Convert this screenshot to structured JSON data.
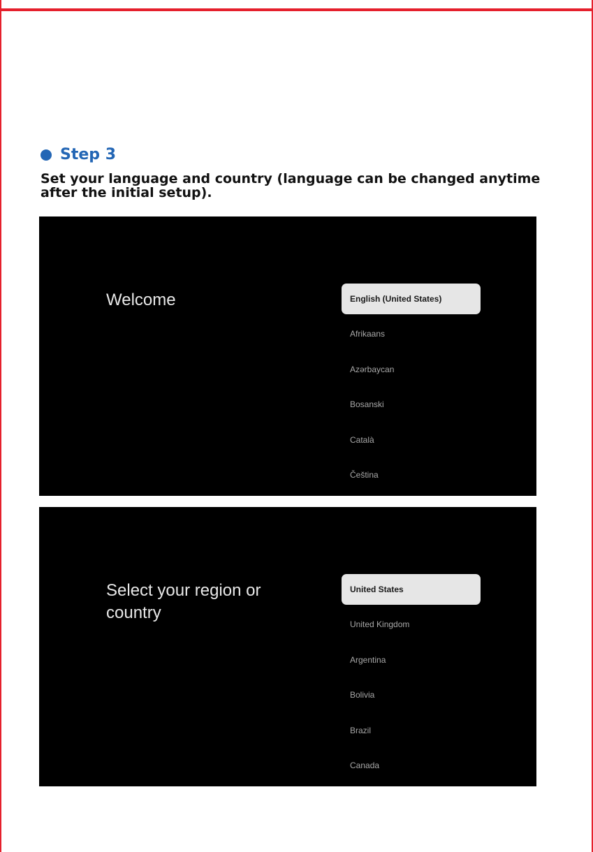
{
  "step": {
    "title": "Step 3",
    "description": "Set your language and country (language can be changed anytime after the initial setup)."
  },
  "screens": [
    {
      "title": "Welcome",
      "options": [
        {
          "label": "English (United States)",
          "selected": true
        },
        {
          "label": "Afrikaans",
          "selected": false
        },
        {
          "label": "Azərbaycan",
          "selected": false
        },
        {
          "label": "Bosanski",
          "selected": false
        },
        {
          "label": "Català",
          "selected": false
        },
        {
          "label": "Čeština",
          "selected": false
        }
      ]
    },
    {
      "title": "Select your region or country",
      "options": [
        {
          "label": "United States",
          "selected": true
        },
        {
          "label": "United Kingdom",
          "selected": false
        },
        {
          "label": "Argentina",
          "selected": false
        },
        {
          "label": "Bolivia",
          "selected": false
        },
        {
          "label": "Brazil",
          "selected": false
        },
        {
          "label": "Canada",
          "selected": false
        }
      ]
    }
  ],
  "colors": {
    "frame": "#e5202c",
    "accent": "#2366b5",
    "screen_bg": "#000000",
    "selected_bg": "#e6e6e6"
  }
}
